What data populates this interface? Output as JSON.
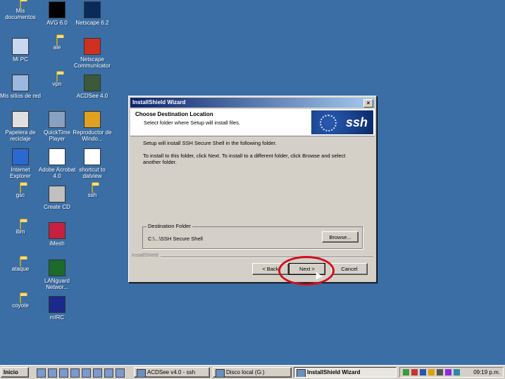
{
  "desktop_icons": [
    {
      "label": "Mis documentos",
      "icon": "folder-icon",
      "col": 0,
      "row": 0
    },
    {
      "label": "Mi PC",
      "icon": "computer-icon",
      "col": 0,
      "row": 1
    },
    {
      "label": "Mis sitios de red",
      "icon": "network-icon",
      "col": 0,
      "row": 2
    },
    {
      "label": "Papelera de reciclaje",
      "icon": "recycle-bin-icon",
      "col": 0,
      "row": 3
    },
    {
      "label": "Internet Explorer",
      "icon": "ie-icon",
      "col": 0,
      "row": 4
    },
    {
      "label": "gsc",
      "icon": "folder-icon",
      "col": 0,
      "row": 5
    },
    {
      "label": "ibm",
      "icon": "folder-icon",
      "col": 0,
      "row": 6
    },
    {
      "label": "ataque",
      "icon": "folder-icon",
      "col": 0,
      "row": 7
    },
    {
      "label": "coyote",
      "icon": "folder-icon",
      "col": 0,
      "row": 8
    },
    {
      "label": "AVG 6.0",
      "icon": "avg-icon",
      "col": 1,
      "row": 0
    },
    {
      "label": "ale",
      "icon": "folder-icon",
      "col": 1,
      "row": 1
    },
    {
      "label": "vpn",
      "icon": "folder-icon",
      "col": 1,
      "row": 2
    },
    {
      "label": "QuickTime Player",
      "icon": "quicktime-icon",
      "col": 1,
      "row": 3
    },
    {
      "label": "Adobe Acrobat 4.0",
      "icon": "acrobat-icon",
      "col": 1,
      "row": 4
    },
    {
      "label": "Create CD",
      "icon": "create-cd-icon",
      "col": 1,
      "row": 5
    },
    {
      "label": "iMesh",
      "icon": "imesh-icon",
      "col": 1,
      "row": 6
    },
    {
      "label": "LANguard Networ...",
      "icon": "languard-icon",
      "col": 1,
      "row": 7
    },
    {
      "label": "mIRC",
      "icon": "mirc-icon",
      "col": 1,
      "row": 8
    },
    {
      "label": "Netscape 6.2",
      "icon": "netscape-icon",
      "col": 2,
      "row": 0
    },
    {
      "label": "Netscape Communicator",
      "icon": "communicator-icon",
      "col": 2,
      "row": 1
    },
    {
      "label": "ACDSee 4.0",
      "icon": "acdsee-icon",
      "col": 2,
      "row": 2
    },
    {
      "label": "Reproductor de Windo...",
      "icon": "media-player-icon",
      "col": 2,
      "row": 3
    },
    {
      "label": "shortcut to datview",
      "icon": "eyes-icon",
      "col": 2,
      "row": 4
    },
    {
      "label": "ssh",
      "icon": "folder-icon",
      "col": 2,
      "row": 5
    }
  ],
  "dialog": {
    "title": "InstallShield Wizard",
    "close_label": "×",
    "header_title": "Choose Destination Location",
    "header_subtitle": "Select folder where Setup will install files.",
    "logo_text": "ssh",
    "line1": "Setup will install SSH Secure Shell in the following folder.",
    "line2": "To install to this folder, click Next. To install to a different folder, click Browse and select another folder.",
    "group_title": "Destination Folder",
    "destination_path": "C:\\...\\SSH Secure Shell",
    "browse_label": "Browse...",
    "footer_brand": "InstallShield",
    "back_label": "< Back",
    "next_label": "Next >",
    "cancel_label": "Cancel"
  },
  "taskbar": {
    "start_label": "Inicio",
    "tasks": [
      {
        "label": "ACDSee v4.0 - ssh",
        "active": false
      },
      {
        "label": "Disco local (G:)",
        "active": false
      },
      {
        "label": "InstallShield Wizard",
        "active": true
      }
    ],
    "clock": "09:19 p.m."
  },
  "colors": {
    "desktop": "#3a6ea5",
    "annotation": "#d01020"
  }
}
